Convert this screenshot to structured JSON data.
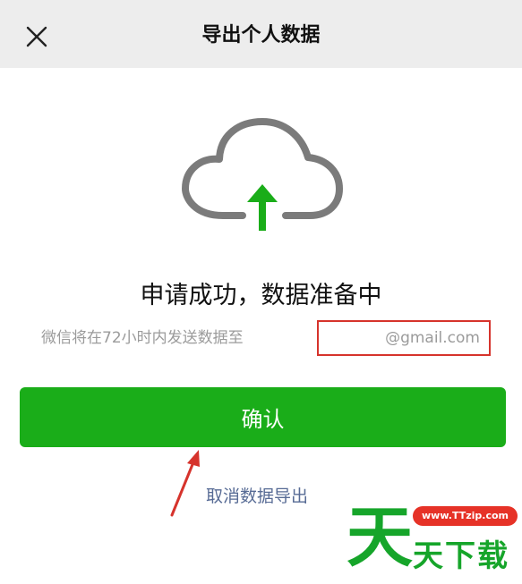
{
  "header": {
    "title": "导出个人数据",
    "close_icon": "close-icon"
  },
  "main": {
    "cloud_icon": "cloud-upload-icon",
    "headline": "申请成功，数据准备中",
    "description": "微信将在72小时内发送数据至",
    "email": "@gmail.com",
    "confirm_label": "确认",
    "cancel_label": "取消数据导出"
  },
  "watermark": {
    "big_char": "天",
    "text": "天下载",
    "url": "www.TTzip.com"
  },
  "colors": {
    "primary_green": "#1aad19",
    "link_blue": "#576b95",
    "highlight_red": "#d6332c",
    "navbar_bg": "#ededed",
    "icon_gray": "#7b7b7b"
  }
}
